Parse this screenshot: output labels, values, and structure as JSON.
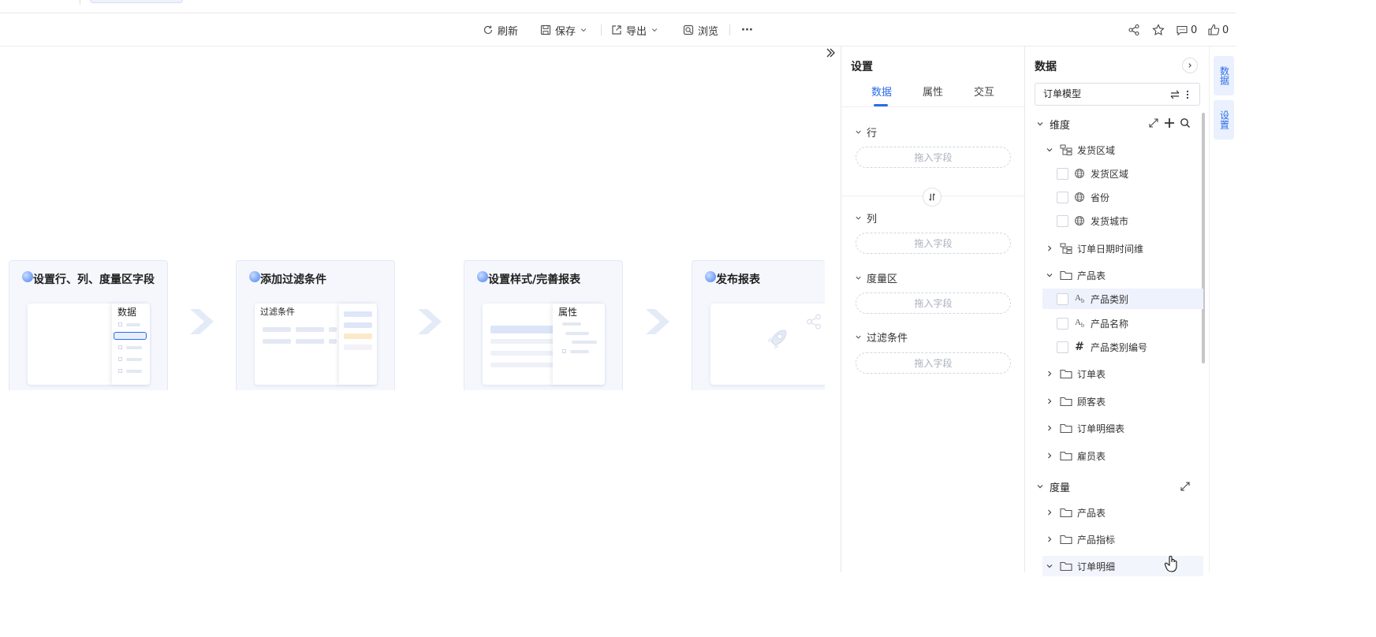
{
  "toolbar": {
    "refresh": "刷新",
    "save": "保存",
    "export": "导出",
    "preview": "浏览",
    "more": "···",
    "comment_count": "0",
    "like_count": "0"
  },
  "steps": [
    {
      "title": "设置行、列、度量区字段",
      "panel_title": "数据"
    },
    {
      "title": "添加过滤条件",
      "panel_title": "过滤条件"
    },
    {
      "title": "设置样式/完善报表",
      "panel_title": "属性"
    },
    {
      "title": "发布报表"
    }
  ],
  "settings": {
    "title": "设置",
    "tabs": [
      "数据",
      "属性",
      "交互"
    ],
    "active_tab": "数据",
    "sections": [
      {
        "label": "行",
        "placeholder": "拖入字段"
      },
      {
        "label": "列",
        "placeholder": "拖入字段"
      },
      {
        "label": "度量区",
        "placeholder": "拖入字段"
      },
      {
        "label": "过滤条件",
        "placeholder": "拖入字段"
      }
    ]
  },
  "data_panel": {
    "title": "数据",
    "model": "订单模型",
    "dimension_label": "维度",
    "measure_label": "度量",
    "tree": [
      {
        "label": "发货区域",
        "type": "hierarchy",
        "expanded": true,
        "level": 0
      },
      {
        "label": "发货区域",
        "type": "geo",
        "level": 1
      },
      {
        "label": "省份",
        "type": "geo",
        "level": 1
      },
      {
        "label": "发货城市",
        "type": "geo",
        "level": 1
      },
      {
        "label": "订单日期时间维",
        "type": "hierarchy",
        "expanded": false,
        "level": 0
      },
      {
        "label": "产品表",
        "type": "folder",
        "expanded": true,
        "level": 0
      },
      {
        "label": "产品类别",
        "type": "text",
        "level": 1,
        "highlight": true
      },
      {
        "label": "产品名称",
        "type": "text",
        "level": 1
      },
      {
        "label": "产品类别编号",
        "type": "number",
        "level": 1
      },
      {
        "label": "订单表",
        "type": "folder",
        "expanded": false,
        "level": 0
      },
      {
        "label": "顾客表",
        "type": "folder",
        "expanded": false,
        "level": 0
      },
      {
        "label": "订单明细表",
        "type": "folder",
        "expanded": false,
        "level": 0
      },
      {
        "label": "雇员表",
        "type": "folder",
        "expanded": false,
        "level": 0
      }
    ],
    "measures": [
      {
        "label": "产品表",
        "expanded": false
      },
      {
        "label": "产品指标",
        "expanded": false
      },
      {
        "label": "订单明细",
        "expanded": true
      }
    ]
  },
  "side_tabs": [
    "数据",
    "设置"
  ]
}
